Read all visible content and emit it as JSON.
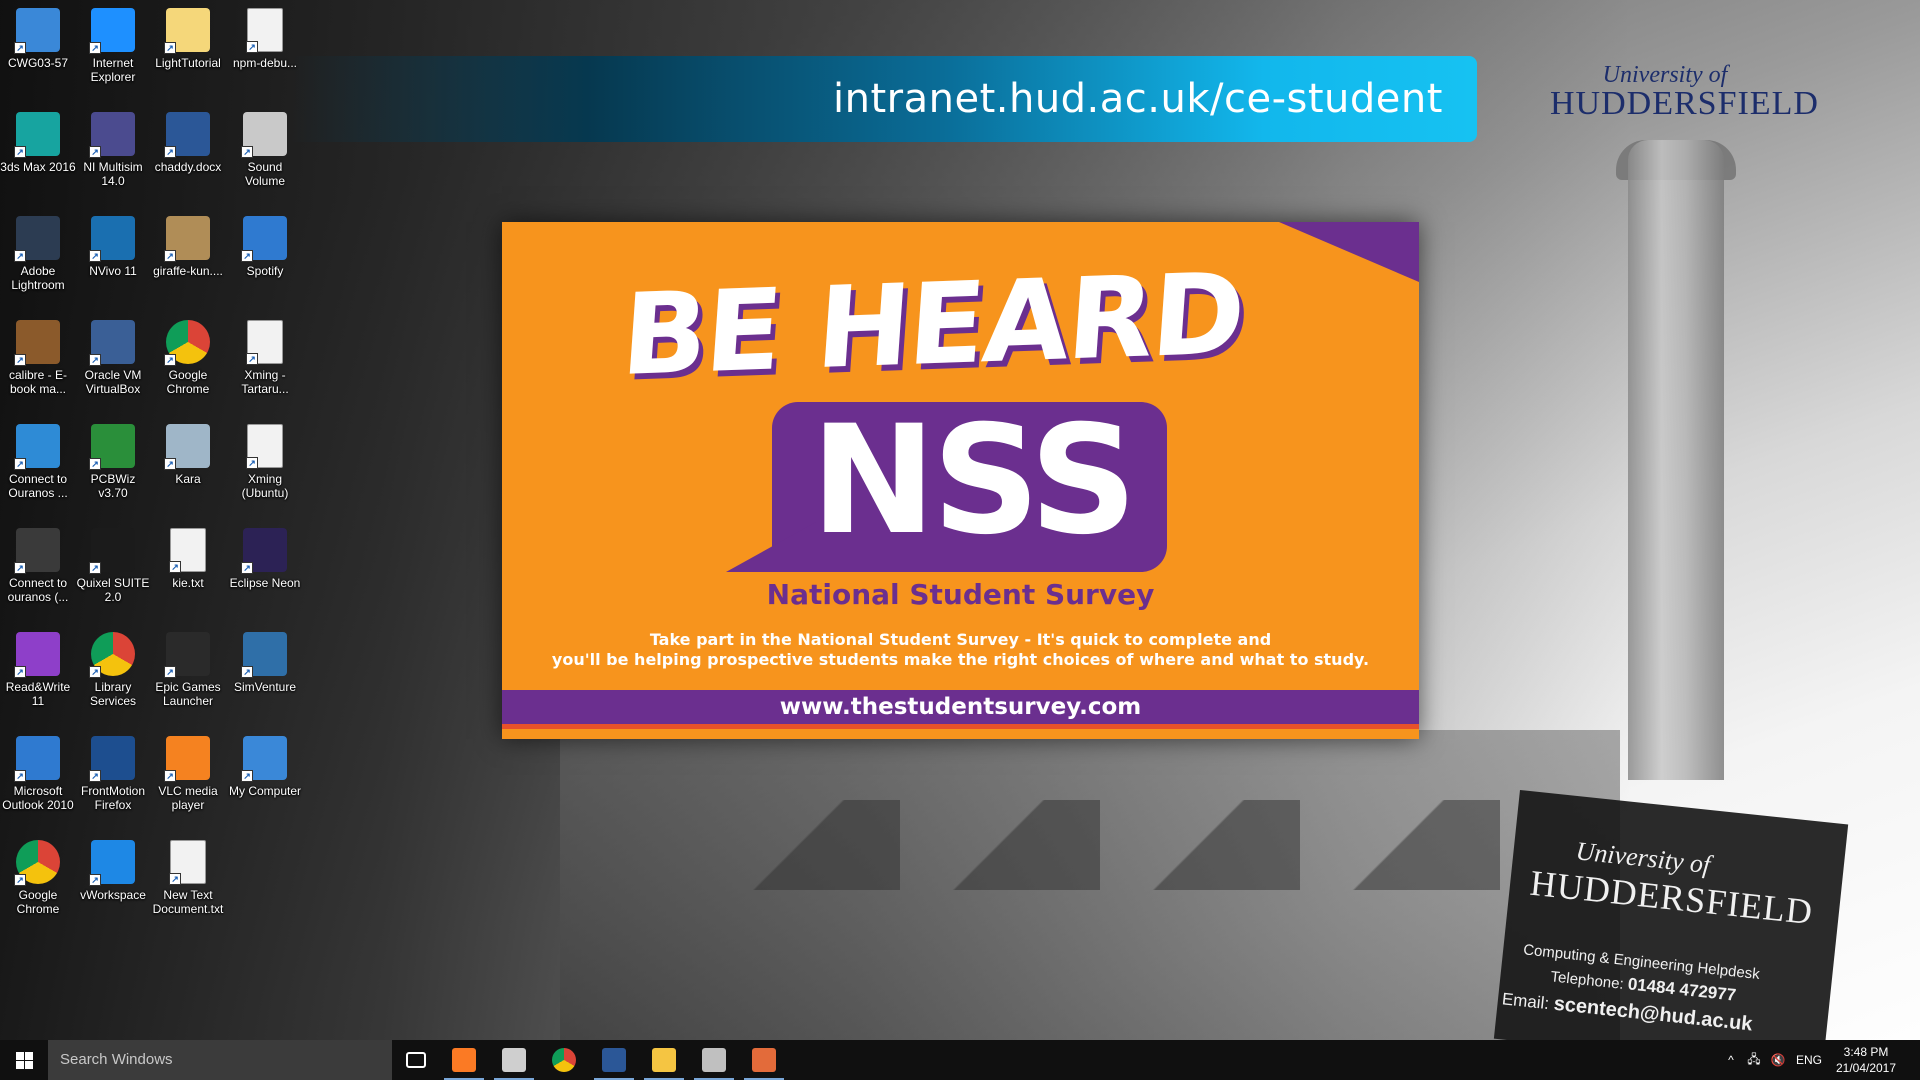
{
  "desktop": {
    "icons": [
      {
        "label": "CWG03-57",
        "icon": "computer-icon",
        "color": "#3a88d8"
      },
      {
        "label": "Internet Explorer",
        "icon": "internet-explorer-icon",
        "color": "#1e90ff"
      },
      {
        "label": "LightTutorial",
        "icon": "folder-icon",
        "color": "#f5d77a"
      },
      {
        "label": "npm-debu...",
        "icon": "text-file-icon",
        "color": "#f2f2f2"
      },
      {
        "label": "3ds Max 2016",
        "icon": "3ds-max-icon",
        "color": "#17a4a0"
      },
      {
        "label": "NI Multisim 14.0",
        "icon": "multisim-icon",
        "color": "#4b4b8f"
      },
      {
        "label": "chaddy.docx",
        "icon": "word-document-icon",
        "color": "#2b5797"
      },
      {
        "label": "Sound Volume",
        "icon": "speaker-icon",
        "color": "#c9c9c9"
      },
      {
        "label": "Adobe Lightroom",
        "icon": "lightroom-icon",
        "color": "#2c3c52"
      },
      {
        "label": "NVivo 11",
        "icon": "nvivo-icon",
        "color": "#1a6fb0"
      },
      {
        "label": "giraffe-kun....",
        "icon": "image-file-icon",
        "color": "#b08d57"
      },
      {
        "label": "Spotify",
        "icon": "spotify-icon",
        "color": "#2f7ad0"
      },
      {
        "label": "calibre - E-book ma...",
        "icon": "calibre-icon",
        "color": "#8b5a2b"
      },
      {
        "label": "Oracle VM VirtualBox",
        "icon": "virtualbox-icon",
        "color": "#3a5f96"
      },
      {
        "label": "Google Chrome",
        "icon": "chrome-icon",
        "color": "#db4437"
      },
      {
        "label": "Xming - Tartaru...",
        "icon": "text-file-icon",
        "color": "#f2f2f2"
      },
      {
        "label": "Connect to Ouranos ...",
        "icon": "remote-desktop-icon",
        "color": "#2e8bd6"
      },
      {
        "label": "PCBWiz v3.70",
        "icon": "pcb-icon",
        "color": "#2a8f3a"
      },
      {
        "label": "Kara",
        "icon": "kara-icon",
        "color": "#9fb6c8"
      },
      {
        "label": "Xming (Ubuntu)",
        "icon": "text-file-icon",
        "color": "#f2f2f2"
      },
      {
        "label": "Connect to ouranos (...",
        "icon": "x-connect-icon",
        "color": "#3a3a3a"
      },
      {
        "label": "Quixel SUITE 2.0",
        "icon": "quixel-icon",
        "color": "#1b1b1b"
      },
      {
        "label": "kie.txt",
        "icon": "text-file-icon",
        "color": "#f2f2f2"
      },
      {
        "label": "Eclipse Neon",
        "icon": "eclipse-icon",
        "color": "#2c2255"
      },
      {
        "label": "Read&Write 11",
        "icon": "readwrite-icon",
        "color": "#8e3fc9"
      },
      {
        "label": "Library Services",
        "icon": "chrome-icon",
        "color": "#db4437"
      },
      {
        "label": "Epic Games Launcher",
        "icon": "epic-games-icon",
        "color": "#2a2a2a"
      },
      {
        "label": "SimVenture",
        "icon": "simventure-icon",
        "color": "#2f6fa8"
      },
      {
        "label": "Microsoft Outlook 2010",
        "icon": "outlook-icon",
        "color": "#2f7ad0"
      },
      {
        "label": "FrontMotion Firefox",
        "icon": "firefox-icon",
        "color": "#1d4e8f"
      },
      {
        "label": "VLC media player",
        "icon": "vlc-icon",
        "color": "#f58220"
      },
      {
        "label": "My Computer",
        "icon": "my-computer-icon",
        "color": "#3a88d8"
      },
      {
        "label": "Google Chrome",
        "icon": "chrome-icon",
        "color": "#db4437"
      },
      {
        "label": "vWorkspace",
        "icon": "vworkspace-icon",
        "color": "#1e88e5"
      },
      {
        "label": "New Text Document.txt",
        "icon": "text-file-icon",
        "color": "#f2f2f2"
      }
    ]
  },
  "wallpaper": {
    "banner_url": "intranet.hud.ac.uk/ce-student",
    "logo_of": "University of",
    "logo_name": "HUDDERSFIELD",
    "nss": {
      "headline": "BE HEARD",
      "acronym": "NSS",
      "subtitle": "National Student Survey",
      "description_line1": "Take part in the National Student Survey - It's quick to complete and",
      "description_line2": "you'll be helping prospective students make the right choices of where and what to study.",
      "url": "www.thestudentsurvey.com",
      "orange": "#f7941d",
      "purple": "#6b2f8f"
    },
    "helpdesk": {
      "of": "University of",
      "name": "HUDDERSFIELD",
      "title": "Computing & Engineering Helpdesk",
      "telephone_label": "Telephone:",
      "telephone": "01484 472977",
      "email_label": "Email:",
      "email": "scentech@hud.ac.uk"
    }
  },
  "taskbar": {
    "search_placeholder": "Search Windows",
    "apps": [
      {
        "name": "task-view-icon",
        "color": "#ffffff",
        "active": false
      },
      {
        "name": "xampp-icon",
        "color": "#fb7a24",
        "active": true
      },
      {
        "name": "command-prompt-icon",
        "color": "#cfcfcf",
        "active": true
      },
      {
        "name": "chrome-icon",
        "color": "#db4437",
        "active": false
      },
      {
        "name": "word-icon",
        "color": "#2b5797",
        "active": true
      },
      {
        "name": "file-explorer-icon",
        "color": "#f5c542",
        "active": true
      },
      {
        "name": "tool-icon",
        "color": "#c0c0c0",
        "active": true
      },
      {
        "name": "paint-icon",
        "color": "#e36b3a",
        "active": true
      }
    ],
    "language": "ENG",
    "time": "3:48 PM",
    "date": "21/04/2017"
  }
}
